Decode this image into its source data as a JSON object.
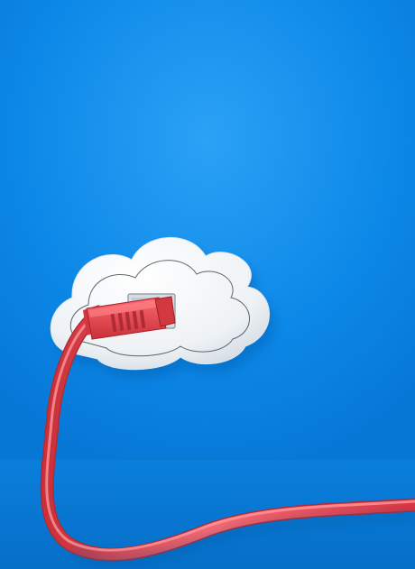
{
  "image": {
    "kind": "photo-illustration",
    "subject": "red-ethernet-cable-plugged-into-cloud",
    "colors": {
      "wall": "#0a86e6",
      "wall_highlight": "#1e9bf3",
      "floor": "#0976d4",
      "cloud": "#f4f6f8",
      "cloud_shadow": "#c9d3dc",
      "cable": "#e8434c",
      "cable_highlight": "#ff7a80",
      "cable_shadow": "#b42a33",
      "port": "#d9dde2"
    }
  }
}
